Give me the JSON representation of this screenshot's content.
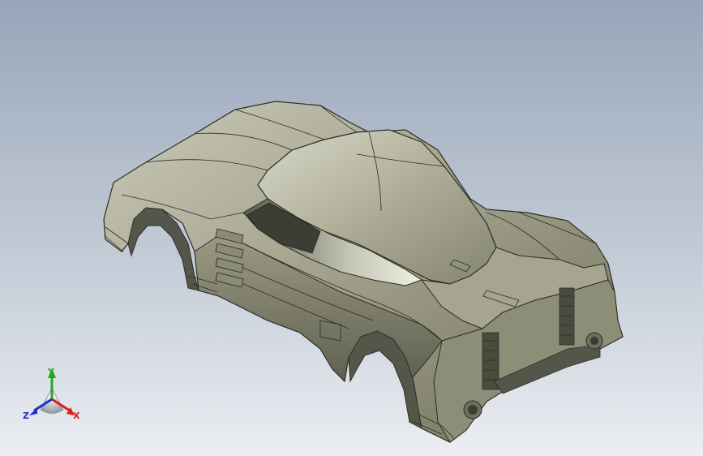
{
  "viewport": {
    "model": "car-body-shell",
    "colors": {
      "background_top": "#98a6ba",
      "background_bottom": "#ebeef2",
      "body_shade": "#8a8b73",
      "body_light": "#c9c9b8",
      "edge": "#2c2c25"
    }
  },
  "triad": {
    "x_label": "X",
    "y_label": "Y",
    "z_label": "Z",
    "colors": {
      "x": "#d62020",
      "y": "#22a822",
      "z": "#2030d0"
    }
  }
}
